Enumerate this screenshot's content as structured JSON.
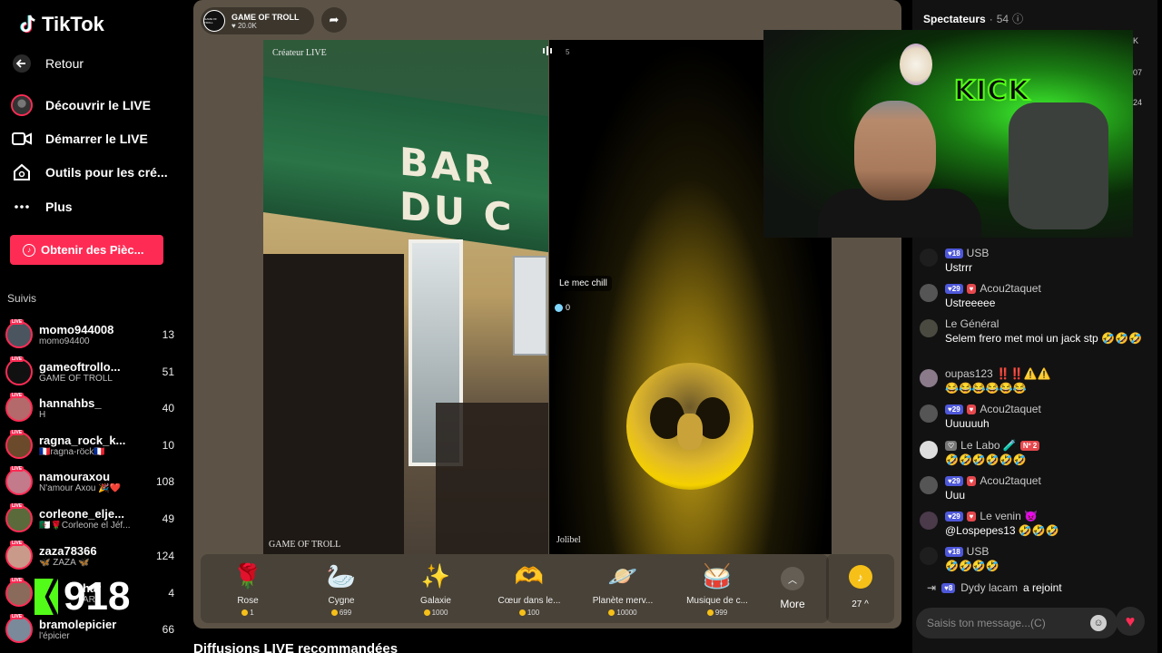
{
  "app": {
    "logo_text": "TikTok"
  },
  "nav": {
    "back": "Retour",
    "items": [
      {
        "label": "Découvrir le LIVE",
        "icon": "live-avatar-icon"
      },
      {
        "label": "Démarrer le LIVE",
        "icon": "video-camera-icon"
      },
      {
        "label": "Outils pour les cré...",
        "icon": "home-tools-icon"
      },
      {
        "label": "Plus",
        "icon": "more-dots-icon"
      }
    ],
    "coins_button": "Obtenir des Pièc..."
  },
  "following": {
    "title": "Suivis",
    "live_badge": "LIVE",
    "accounts": [
      {
        "name": "momo944008",
        "sub": "momo94400",
        "count": "13"
      },
      {
        "name": "gameoftrollo...",
        "sub": "GAME OF TROLL",
        "count": "51"
      },
      {
        "name": "hannahbs_",
        "sub": "H",
        "count": "40"
      },
      {
        "name": "ragna_rock_k...",
        "sub": "🇫🇷ragna-röck🇫🇷",
        "count": "10"
      },
      {
        "name": "namouraxou",
        "sub": "N'amour Axou 🎉❤️",
        "count": "108"
      },
      {
        "name": "corleone_elje...",
        "sub": "🇩🇿🌹Corleone el Jéf...",
        "count": "49"
      },
      {
        "name": "zaza78366",
        "sub": "🦋 ZAZA 🦋",
        "count": "124"
      },
      {
        "name": "har",
        "sub": "AR2",
        "count": "4"
      },
      {
        "name": "bramolepicier",
        "sub": "l'épicier",
        "count": "66"
      }
    ]
  },
  "overlay": {
    "kick_count": "918"
  },
  "live": {
    "host_name": "GAME OF TROLL",
    "host_likes": "20.0K",
    "host_avatar_text": "GAME OF TROLL",
    "creator_label": "Créateur LIVE",
    "left_video_name": "GAME OF TROLL",
    "right_video_name": "Jolibel",
    "guest_tag": "Le mec chill",
    "guest_score": "0",
    "mute_count": "5",
    "awning_text": "BAR DU C",
    "webcam_sign": "KICK"
  },
  "gifts": [
    {
      "name": "Rose",
      "price": "1",
      "icon": "rose-icon",
      "glyph": "🌹"
    },
    {
      "name": "Cygne",
      "price": "699",
      "icon": "swan-icon",
      "glyph": "🦢"
    },
    {
      "name": "Galaxie",
      "price": "1000",
      "icon": "galaxy-icon",
      "glyph": "✨"
    },
    {
      "name": "Cœur dans le...",
      "price": "100",
      "icon": "heart-hands-icon",
      "glyph": "🫶"
    },
    {
      "name": "Planète merv...",
      "price": "10000",
      "icon": "planet-icon",
      "glyph": "🪐"
    },
    {
      "name": "Musique de c...",
      "price": "999",
      "icon": "music-drum-icon",
      "glyph": "🥁"
    }
  ],
  "gift_more": "More",
  "wallet": {
    "value": "27",
    "glyph": "♪"
  },
  "recommended_title": "Diffusions LIVE recommandées",
  "chat": {
    "title": "Spectateurs",
    "viewer_count": "54",
    "side_numbers": [
      "K",
      "07",
      "24"
    ],
    "messages": [
      {
        "user": "USB",
        "level": "18",
        "text": "Ustrrr",
        "fan": ""
      },
      {
        "user": "Acou2taquet",
        "level": "29",
        "text": "Ustreeeee",
        "fan": "♥"
      },
      {
        "user": "Le Général",
        "level": "",
        "text": "Selem frero met moi un jack stp 🤣🤣🤣",
        "fan": ""
      },
      {
        "user": "oupas123",
        "level": "",
        "text": "😂😂😂😂😂😂",
        "fan": "",
        "extra": "‼️‼️⚠️⚠️"
      },
      {
        "user": "Acou2taquet",
        "level": "29",
        "text": "Uuuuuuh",
        "fan": "♥"
      },
      {
        "user": "Le Labo 🧪",
        "level": "",
        "text": "🤣🤣🤣🤣🤣🤣",
        "fan": "",
        "extra": "Nº 2"
      },
      {
        "user": "Acou2taquet",
        "level": "29",
        "text": "Uuu",
        "fan": "♥"
      },
      {
        "user": "Le venin 👿",
        "level": "29",
        "text": "@Lospepes13 🤣🤣🤣",
        "fan": "♥"
      },
      {
        "user": "USB",
        "level": "18",
        "text": "🤣🤣🤣🤣",
        "fan": ""
      }
    ],
    "join": {
      "level": "8",
      "user": "Dydy lacam",
      "action": "a rejoint"
    },
    "input_placeholder": "Saisis ton message...(C)"
  },
  "colors": {
    "accent": "#fe2c55",
    "panel": "#5c5346",
    "kick_green": "#53fc18",
    "level_badge": "#4e58d9"
  }
}
